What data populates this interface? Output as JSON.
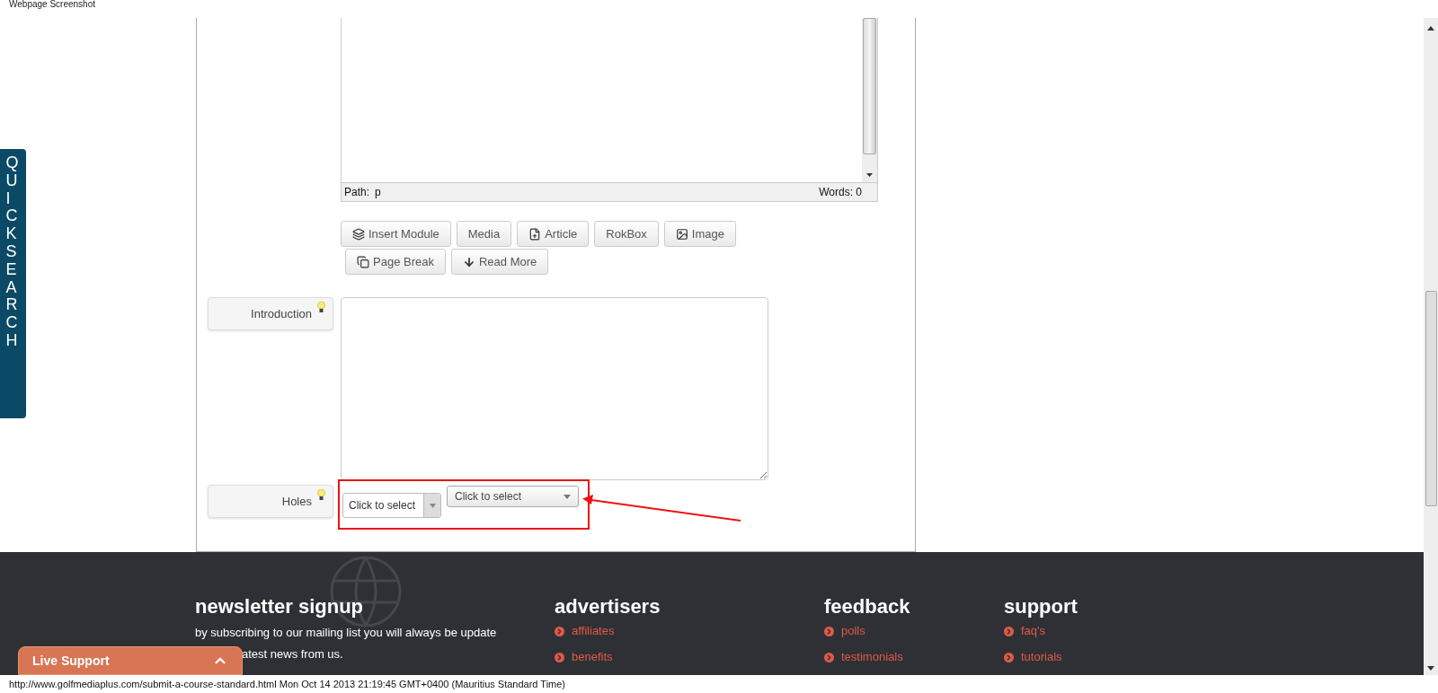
{
  "window": {
    "title": "Webpage Screenshot"
  },
  "quick_search": {
    "label": "QUICK SEARCH"
  },
  "editor": {
    "path_label": "Path:",
    "path": "p",
    "words": "Words: 0"
  },
  "editor_buttons": [
    [
      {
        "label": "Insert Module",
        "kind": "stack"
      },
      {
        "label": "Media"
      },
      {
        "label": "Article",
        "kind": "file-plus"
      },
      {
        "label": "RokBox"
      },
      {
        "label": "Image",
        "kind": "image"
      }
    ],
    [
      {
        "label": "Page Break",
        "kind": "pages"
      },
      {
        "label": "Read More",
        "kind": "arrow-down"
      }
    ]
  ],
  "fields": [
    {
      "label": "Introduction",
      "kind": "textarea"
    },
    {
      "label": "Holes",
      "kind": "selects",
      "selects": [
        {
          "text": "Click to select",
          "kind": "split"
        },
        {
          "text": "Click to select",
          "kind": "plain"
        }
      ]
    }
  ],
  "footer": {
    "columns": [
      {
        "heading": "newsletter signup",
        "lines": [
          "by subscribing to our mailing list you will always be update",
          "atest news from us."
        ]
      },
      {
        "heading": "advertisers",
        "links": [
          "affiliates",
          "benefits"
        ]
      },
      {
        "heading": "feedback",
        "links": [
          "polls",
          "testimonials"
        ]
      },
      {
        "heading": "support",
        "links": [
          "faq's",
          "tutorials"
        ]
      }
    ]
  },
  "live_support": {
    "label": "Live Support"
  },
  "status_line": "http://www.golfmediaplus.com/submit-a-course-standard.html Mon Oct 14 2013 21:19:45 GMT+0400 (Mauritius Standard Time)"
}
